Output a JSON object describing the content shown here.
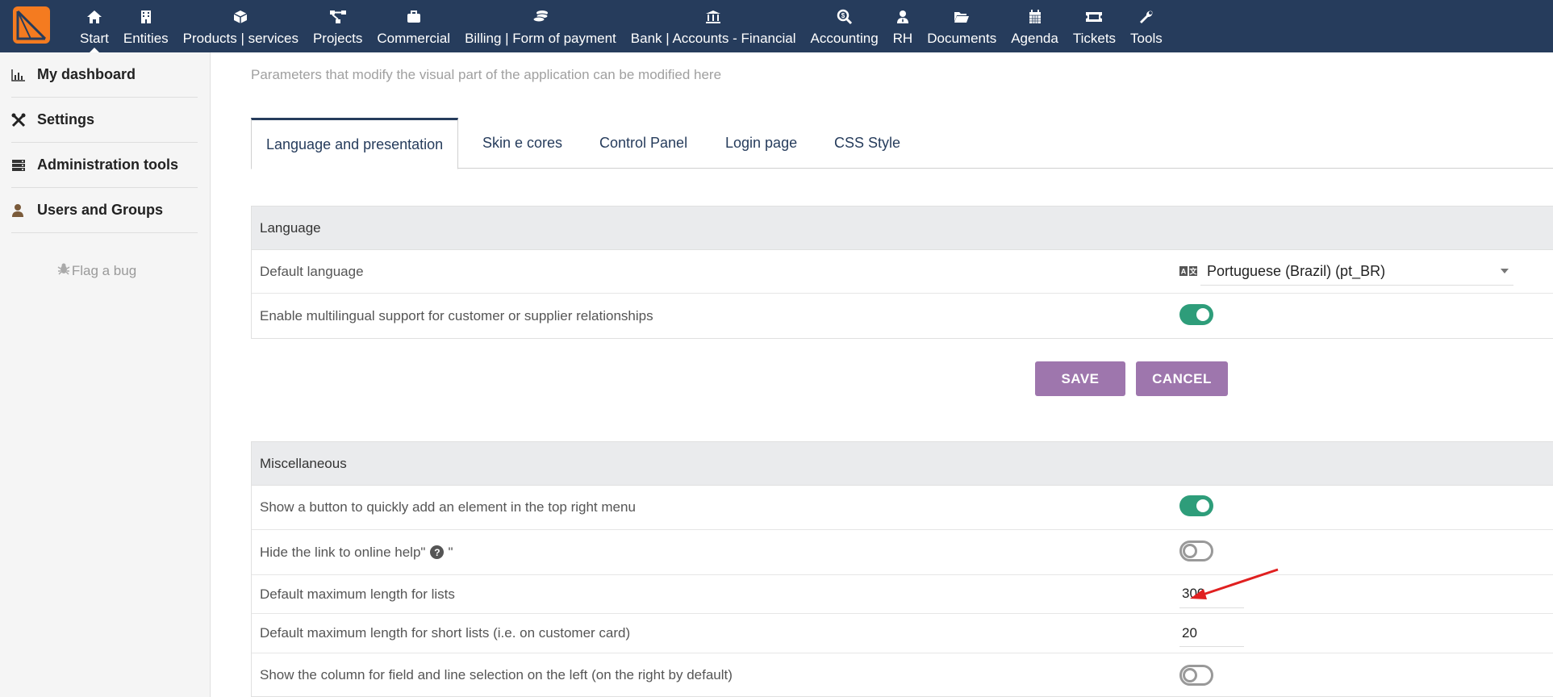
{
  "topbar": {
    "menu": [
      {
        "label": "Start",
        "icon": "home-icon"
      },
      {
        "label": "Entities",
        "icon": "building-icon"
      },
      {
        "label": "Products | services",
        "icon": "cube-icon"
      },
      {
        "label": "Projects",
        "icon": "sitemap-icon"
      },
      {
        "label": "Commercial",
        "icon": "suitcase-icon"
      },
      {
        "label": "Billing | Form of payment",
        "icon": "coins-icon"
      },
      {
        "label": "Bank | Accounts - Financial",
        "icon": "bank-icon"
      },
      {
        "label": "Accounting",
        "icon": "search-dollar-icon"
      },
      {
        "label": "RH",
        "icon": "user-tie-icon"
      },
      {
        "label": "Documents",
        "icon": "folder-open-icon"
      },
      {
        "label": "Agenda",
        "icon": "calendar-icon"
      },
      {
        "label": "Tickets",
        "icon": "ticket-icon"
      },
      {
        "label": "Tools",
        "icon": "wrench-icon"
      }
    ],
    "colors": {
      "bar": "#263c5c",
      "logo": "#f47b20"
    }
  },
  "sidebar": {
    "items": [
      {
        "label": "My dashboard",
        "icon": "chart-icon"
      },
      {
        "label": "Settings",
        "icon": "tools-icon"
      },
      {
        "label": "Administration tools",
        "icon": "server-icon"
      },
      {
        "label": "Users and Groups",
        "icon": "user-icon"
      }
    ],
    "flag_bug": "Flag a bug"
  },
  "main": {
    "intro": "Parameters that modify the visual part of the application can be modified here",
    "tabs": [
      {
        "label": "Language and presentation",
        "active": true
      },
      {
        "label": "Skin e cores"
      },
      {
        "label": "Control Panel"
      },
      {
        "label": "Login page"
      },
      {
        "label": "CSS Style"
      }
    ],
    "language_panel": {
      "title": "Language",
      "default_language_label": "Default language",
      "default_language_value": "Portuguese (Brazil) (pt_BR)",
      "multilingual_label": "Enable multilingual support for customer or supplier relationships",
      "multilingual_on": true
    },
    "buttons": {
      "save": "SAVE",
      "cancel": "CANCEL",
      "color": "#9e76ad"
    },
    "misc_panel": {
      "title": "Miscellaneous",
      "quick_add_label": "Show a button to quickly add an element in the top right menu",
      "quick_add_on": true,
      "hide_help_label": "Hide the link to online help\"",
      "hide_help_suffix": "\"",
      "hide_help_on": false,
      "max_length_label": "Default maximum length for lists",
      "max_length_value": "300",
      "short_list_label": "Default maximum length for short lists (i.e. on customer card)",
      "short_list_value": "20",
      "column_left_label": "Show the column for field and line selection on the left (on the right by default)",
      "column_left_on": false
    },
    "toggle_on_color": "#2e9d7a",
    "annotation_arrow_color": "#e02020"
  }
}
